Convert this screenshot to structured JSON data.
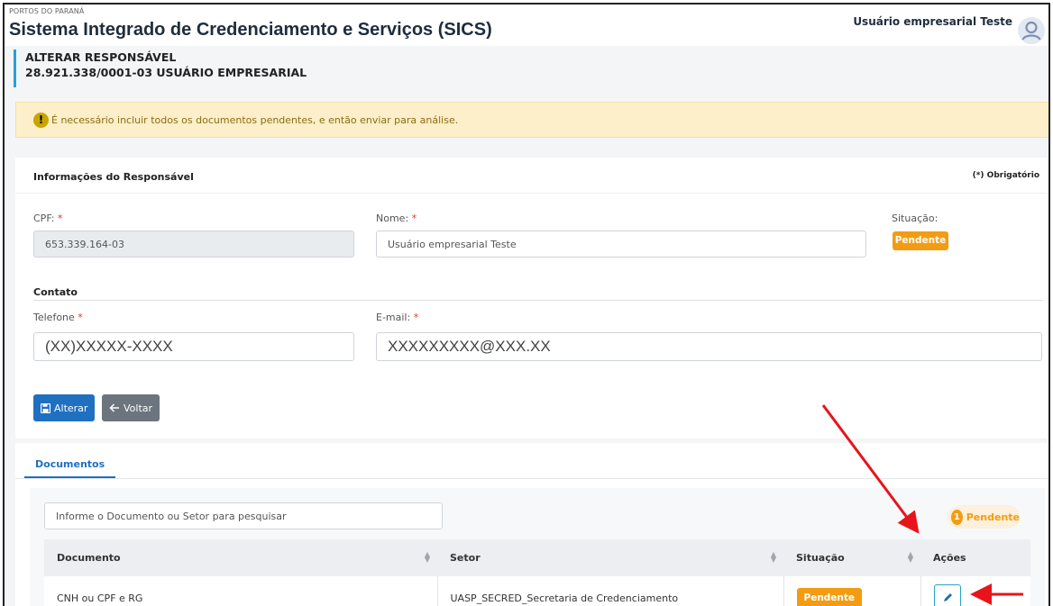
{
  "header": {
    "org": "PORTOS DO PARANÁ",
    "title": "Sistema Integrado de Credenciamento e Serviços (SICS)",
    "user": "Usuário empresarial Teste"
  },
  "page": {
    "title": "ALTERAR RESPONSÁVEL",
    "subtitle": "28.921.338/0001-03 USUÁRIO EMPRESARIAL"
  },
  "alert": {
    "icon": "!",
    "text": "É necessário incluir todos os documentos pendentes, e então enviar para análise."
  },
  "responsavel": {
    "title": "Informações do Responsável",
    "required_note": "(*) Obrigatório",
    "cpf_label": "CPF:",
    "cpf_value": "653.339.164-03",
    "nome_label": "Nome:",
    "nome_value": "Usuário empresarial Teste",
    "situacao_label": "Situação:",
    "situacao_value": "Pendente",
    "required_mark": "*"
  },
  "contato": {
    "title": "Contato",
    "telefone_label": "Telefone",
    "telefone_value": "(XX)XXXXX-XXXX",
    "email_label": "E-mail:",
    "email_value": "XXXXXXXXX@XXX.XX"
  },
  "buttons": {
    "alterar": "Alterar",
    "voltar": "Voltar"
  },
  "documentos": {
    "tab": "Documentos",
    "search_placeholder": "Informe o Documento ou Setor para pesquisar",
    "pending_count": "1",
    "pending_label": "Pendente",
    "columns": [
      "Documento",
      "Setor",
      "Situação",
      "Ações"
    ],
    "rows": [
      {
        "documento": "CNH ou CPF e RG",
        "setor": "UASP_SECRED_Secretaria de Credenciamento",
        "situacao": "Pendente"
      }
    ]
  },
  "colors": {
    "accent": "#1f70c1",
    "pending": "#f39c12",
    "annotation_arrow": "#e8141b"
  }
}
